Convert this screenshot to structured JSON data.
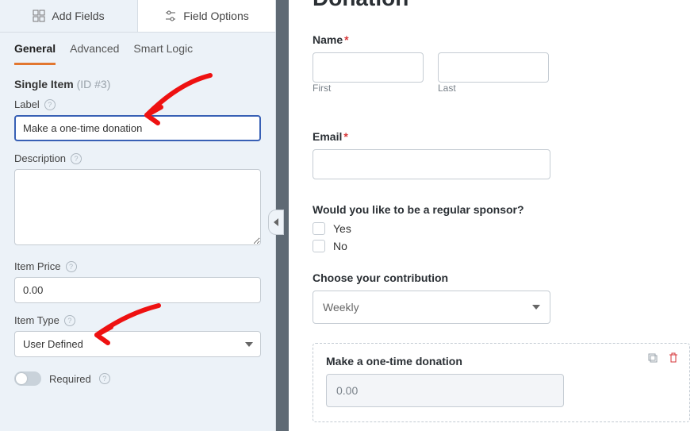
{
  "sidebar": {
    "main_tabs": {
      "add_fields": "Add Fields",
      "field_options": "Field Options"
    },
    "sub_tabs": {
      "general": "General",
      "advanced": "Advanced",
      "smart_logic": "Smart Logic"
    },
    "section_title": "Single Item",
    "section_id": "(ID #3)",
    "label_label": "Label",
    "label_value": "Make a one-time donation",
    "description_label": "Description",
    "description_value": "",
    "price_label": "Item Price",
    "price_value": "0.00",
    "type_label": "Item Type",
    "type_value": "User Defined",
    "required_label": "Required"
  },
  "preview": {
    "form_title": "Donation",
    "name_label": "Name",
    "first_label": "First",
    "last_label": "Last",
    "email_label": "Email",
    "sponsor_label": "Would you like to be a regular sponsor?",
    "yes": "Yes",
    "no": "No",
    "contribution_label": "Choose your contribution",
    "contribution_value": "Weekly",
    "donation_label": "Make a one-time donation",
    "donation_value": "0.00"
  }
}
